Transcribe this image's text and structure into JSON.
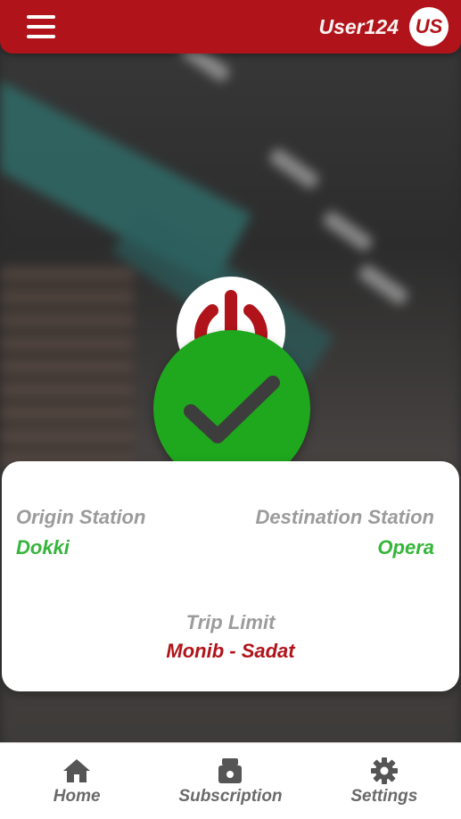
{
  "header": {
    "username": "User124",
    "avatar_initials": "US"
  },
  "trip": {
    "origin_label": "Origin Station",
    "origin_value": "Dokki",
    "destination_label": "Destination Station",
    "destination_value": "Opera",
    "limit_label": "Trip Limit",
    "limit_value": "Monib - Sadat"
  },
  "nav": {
    "items": [
      {
        "label": "Home",
        "icon": "home-icon"
      },
      {
        "label": "Subscription",
        "icon": "ticket-icon"
      },
      {
        "label": "Settings",
        "icon": "gear-icon"
      }
    ]
  },
  "colors": {
    "primary": "#b0141a",
    "success": "#1fa81d",
    "station_value": "#35b53a"
  }
}
